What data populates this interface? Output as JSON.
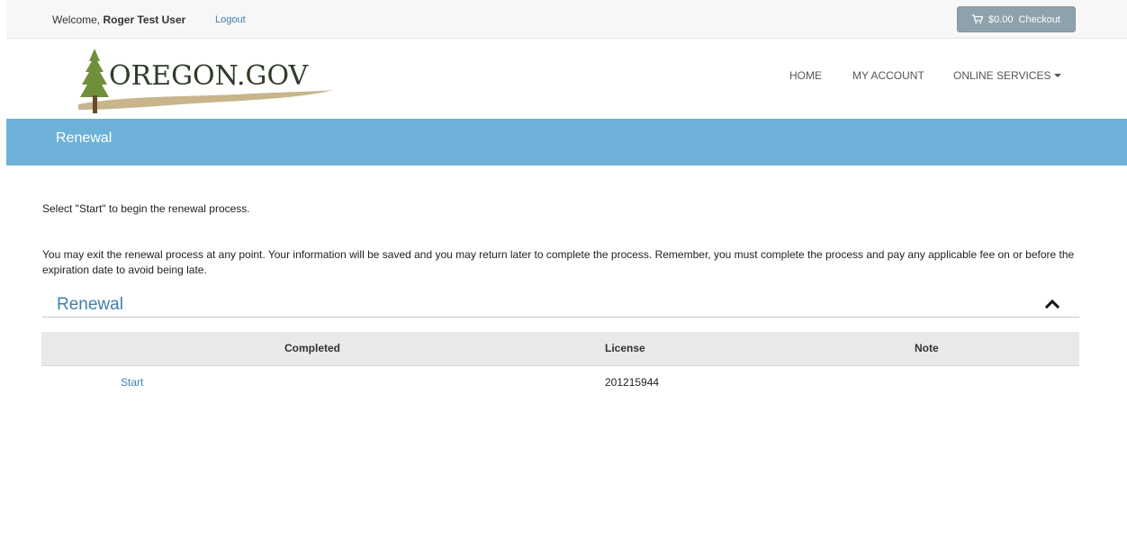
{
  "topbar": {
    "welcome_prefix": "Welcome,",
    "user_name": "Roger Test User",
    "logout_label": "Logout",
    "cart_amount": "$0.00",
    "checkout_label": "Checkout",
    "cart_icon": "shopping-cart-icon"
  },
  "header": {
    "logo_text": "OREGON.GOV",
    "nav": {
      "home": "HOME",
      "my_account": "MY ACCOUNT",
      "online_services": "ONLINE SERVICES"
    }
  },
  "banner": {
    "title": "Renewal"
  },
  "content": {
    "intro_line1": "Select \"Start\" to begin the renewal process.",
    "intro_line2": "You may exit the renewal process at any point. Your information will be saved and you may return later to complete the process. Remember, you must complete the process and pay any applicable fee on or before the expiration date to avoid being late."
  },
  "section": {
    "title": "Renewal",
    "collapse_icon": "chevron-up-icon"
  },
  "table": {
    "columns": [
      "Completed",
      "License",
      "Note"
    ],
    "rows": [
      {
        "completed": "Start",
        "license": "201215944",
        "note": ""
      }
    ]
  },
  "colors": {
    "banner": "#6eb1d9",
    "link": "#3f7fae",
    "checkout_button": "#8ea2ad",
    "table_header": "#e9e9e9"
  }
}
